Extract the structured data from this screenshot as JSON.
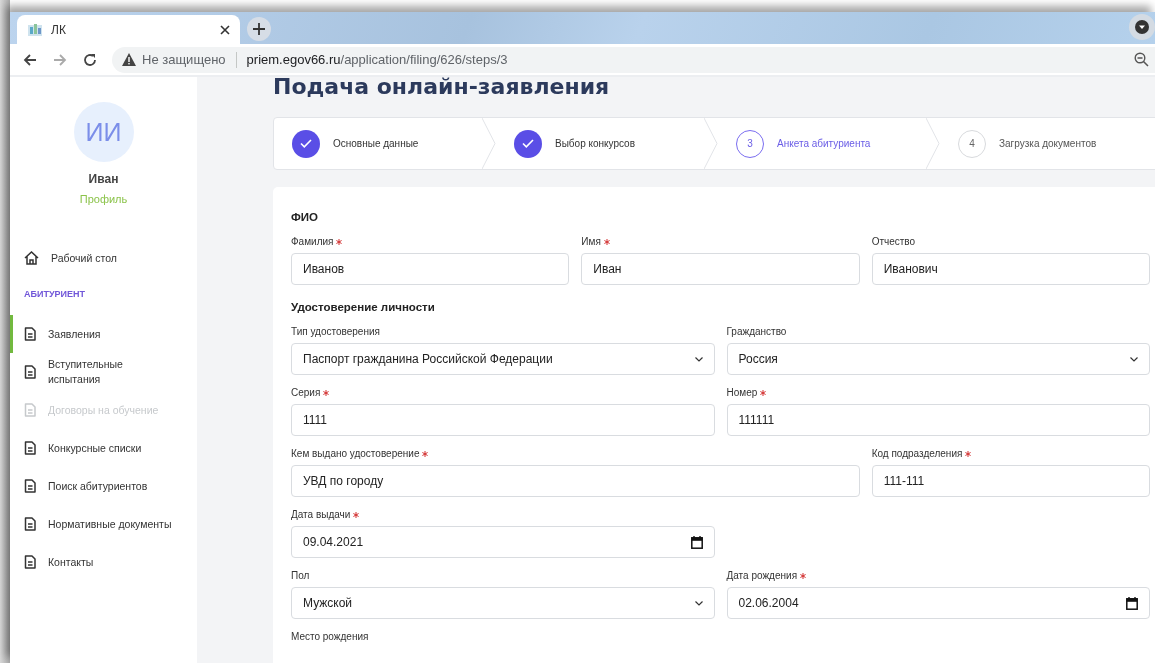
{
  "browser": {
    "tab_title": "ЛК",
    "security": "Не защищено",
    "url_host": "priem.egov66.ru",
    "url_path": "/application/filing/626/steps/3"
  },
  "sidebar": {
    "avatar_initials": "ИИ",
    "user_name": "Иван",
    "profile_link": "Профиль",
    "items": [
      {
        "kind": "home",
        "label": "Рабочий стол",
        "selected": false,
        "disabled": false
      },
      {
        "kind": "heading",
        "label": "АБИТУРИЕНТ"
      },
      {
        "kind": "document",
        "label": "Заявления",
        "selected": true,
        "disabled": false
      },
      {
        "kind": "document",
        "label": "Вступительные испытания",
        "selected": false,
        "disabled": false
      },
      {
        "kind": "document",
        "label": "Договоры на обучение",
        "selected": false,
        "disabled": true
      },
      {
        "kind": "document",
        "label": "Конкурсные списки",
        "selected": false,
        "disabled": false
      },
      {
        "kind": "document",
        "label": "Поиск абитуриентов",
        "selected": false,
        "disabled": false
      },
      {
        "kind": "document",
        "label": "Нормативные документы",
        "selected": false,
        "disabled": false
      },
      {
        "kind": "document",
        "label": "Контакты",
        "selected": false,
        "disabled": false
      }
    ]
  },
  "page_title": "Подача онлайн-заявления",
  "steps": [
    {
      "completed": true,
      "selected": false,
      "label": "Основные данные"
    },
    {
      "completed": true,
      "selected": false,
      "label": "Выбор конкурсов"
    },
    {
      "completed": false,
      "selected": true,
      "number": "3",
      "label": "Анкета абитуриента"
    },
    {
      "completed": false,
      "selected": false,
      "number": "4",
      "label": "Загрузка документов"
    }
  ],
  "sections": [
    {
      "title": "ФИО",
      "rows": [
        [
          {
            "kind": "text",
            "label": "Фамилия",
            "required": true,
            "value": "Иванов"
          },
          {
            "kind": "text",
            "label": "Имя",
            "required": true,
            "value": "Иван"
          },
          {
            "kind": "text",
            "label": "Отчество",
            "required": false,
            "value": "Иванович"
          }
        ]
      ]
    },
    {
      "title": "Удостоверение личности",
      "rows": [
        [
          {
            "kind": "select",
            "label": "Тип удостоверения",
            "required": false,
            "value": "Паспорт гражданина Российской Федерации"
          },
          {
            "kind": "select",
            "label": "Гражданство",
            "required": false,
            "value": "Россия"
          }
        ],
        [
          {
            "kind": "text",
            "label": "Серия",
            "required": true,
            "value": "1111"
          },
          {
            "kind": "text",
            "label": "Номер",
            "required": true,
            "value": "111111"
          }
        ],
        [
          {
            "kind": "text",
            "label": "Кем выдано удостоверение",
            "required": true,
            "value": "УВД по городу",
            "wide": true
          },
          {
            "kind": "text",
            "label": "Код подразделения",
            "required": true,
            "value": "111-111"
          }
        ],
        [
          {
            "kind": "date",
            "label": "Дата выдачи",
            "required": true,
            "value": "09.04.2021"
          }
        ],
        [
          {
            "kind": "select",
            "label": "Пол",
            "required": false,
            "value": "Мужской"
          },
          {
            "kind": "date",
            "label": "Дата рождения",
            "required": true,
            "value": "02.06.2004"
          }
        ],
        [
          {
            "kind": "label-only",
            "label": "Место рождения",
            "required": false
          }
        ]
      ]
    }
  ]
}
